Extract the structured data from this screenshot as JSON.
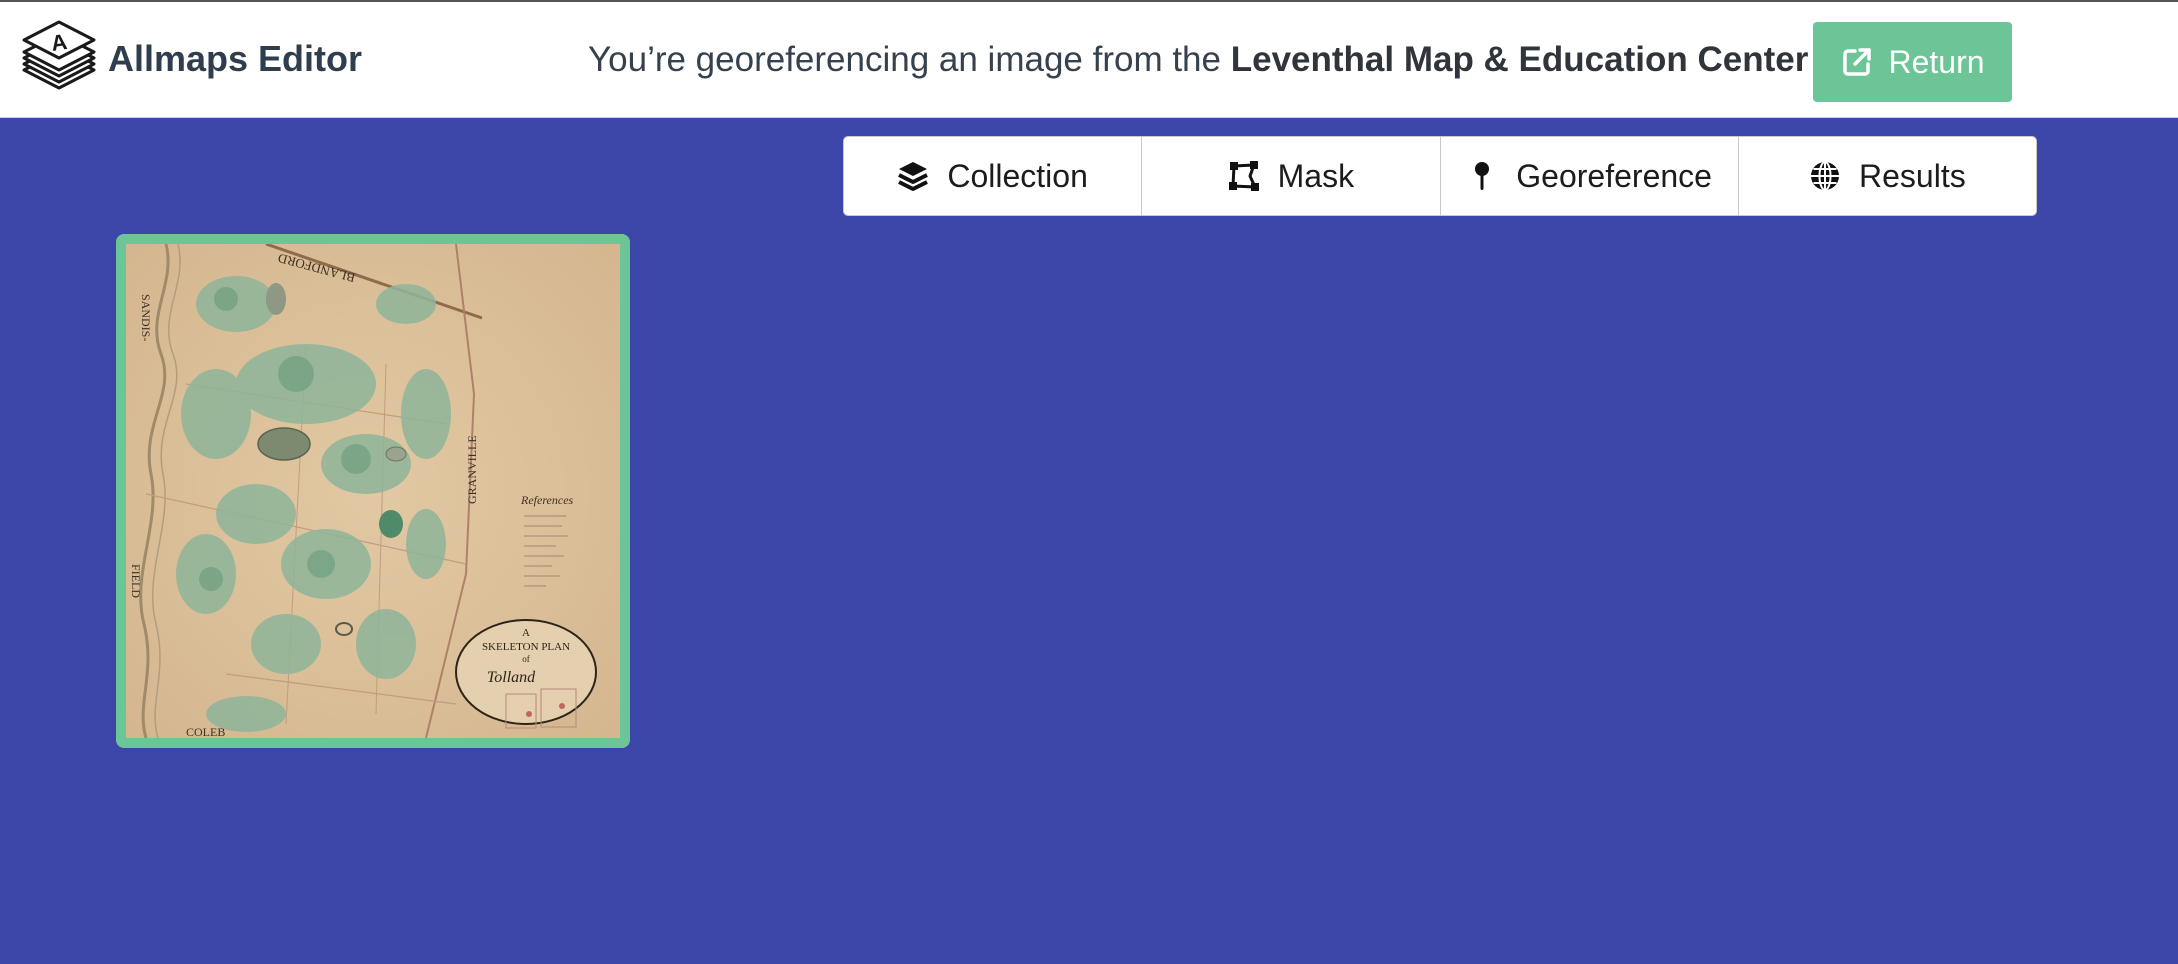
{
  "header": {
    "app_title": "Allmaps Editor",
    "source_prefix": "You’re georeferencing an image from the",
    "source_name": "Leventhal Map & Education Center",
    "return_label": "Return",
    "logo_letter": "A"
  },
  "tabs": [
    {
      "label": "Collection",
      "icon": "layers-icon"
    },
    {
      "label": "Mask",
      "icon": "mask-polygon-icon"
    },
    {
      "label": "Georeference",
      "icon": "map-pin-icon"
    },
    {
      "label": "Results",
      "icon": "globe-icon"
    }
  ],
  "thumbnail": {
    "map_labels": {
      "top": "BLANDFORD",
      "left_upper": "SANDIS-",
      "left_lower": "FIELD",
      "right": "GRANVILLE",
      "legend": "References",
      "bottom": "COLEB",
      "cartouche_line1": "A",
      "cartouche_line2": "SKELETON PLAN",
      "cartouche_line3": "of",
      "cartouche_line4": "Tolland"
    }
  },
  "colors": {
    "background": "#3c45a8",
    "accent": "#6cc597",
    "header_bg": "#ffffff"
  }
}
